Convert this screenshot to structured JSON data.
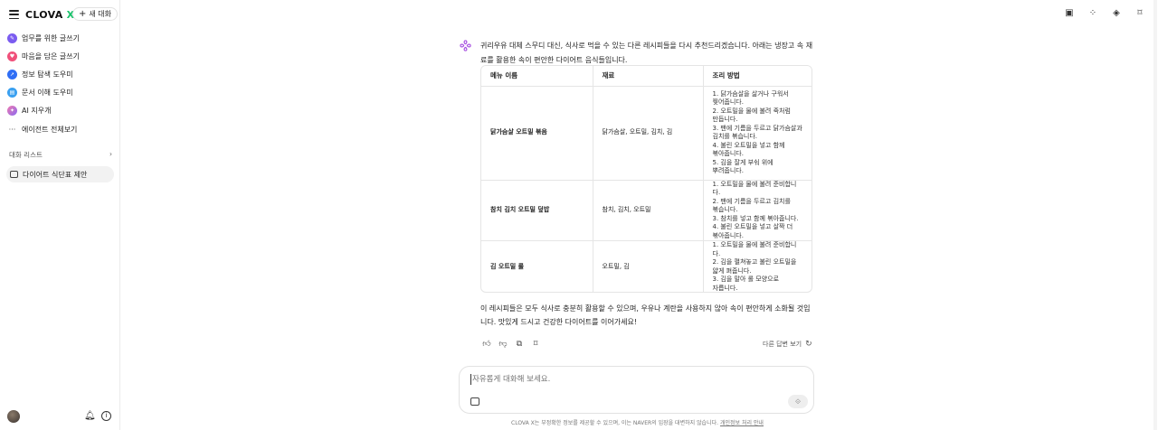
{
  "sidebar": {
    "logo": "CLOVA",
    "logo_x": "X",
    "new_chat": "새 대화",
    "agents": [
      {
        "label": "업무를 위한 글쓰기",
        "color": "#7b5cf0",
        "icon": "pencil-icon"
      },
      {
        "label": "마음을 담은 글쓰기",
        "color": "#f0507a",
        "icon": "heart-icon"
      },
      {
        "label": "정보 탐색 도우미",
        "color": "#2f6ef5",
        "icon": "compass-icon"
      },
      {
        "label": "문서 이해 도우미",
        "color": "#3aa0f0",
        "icon": "document-icon"
      },
      {
        "label": "AI 지우개",
        "color": "#c06af0",
        "icon": "eraser-icon"
      },
      {
        "label": "에이전트 전체보기",
        "color": "",
        "icon": "more-icon"
      }
    ],
    "chat_list_label": "대화 리스트",
    "chat_item": "다이어트 식단표 제안"
  },
  "message": {
    "intro": "귀리우유 대체 스무디 대신, 식사로 먹을 수 있는 다른 레시피들을 다시 추천드리겠습니다. 아래는 냉장고 속 재료를 활용한 속이 편안한 다이어트 음식들입니다.",
    "table": {
      "headers": [
        "메뉴 이름",
        "재료",
        "조리 방법"
      ],
      "rows": [
        {
          "menu": "닭가슴살 오트밀 볶음",
          "ingredients": "닭가슴살, 오트밀, 김치, 김",
          "method": "1. 닭가슴살을 삶거나 구워서\n찢어줍니다.\n2. 오트밀을 물에 불려 죽처럼\n만듭니다.\n3. 팬에 기름을 두르고 닭가슴살과\n김치를 볶습니다.\n4. 불린 오트밀을 넣고 함께\n볶아줍니다.\n5. 김을 잘게 부숴 위에\n뿌려줍니다."
        },
        {
          "menu": "참치 김치 오트밀 덮밥",
          "ingredients": "참치, 김치, 오트밀",
          "method": "1. 오트밀을 물에 불려 준비합니다.\n2. 팬에 기름을 두르고 김치를\n볶습니다.\n3. 참치를 넣고 함께 볶아줍니다.\n4. 불린 오트밀을 넣고 살짝 더\n볶아줍니다."
        },
        {
          "menu": "김 오트밀 롤",
          "ingredients": "오트밀, 김",
          "method": "1. 오트밀을 물에 불려 준비합니다.\n2. 김을 펼쳐놓고 불린 오트밀을\n얇게 펴줍니다.\n3. 김을 말아 롤 모양으로\n자릅니다."
        }
      ]
    },
    "outro": "이 레시피들은 모두 식사로 충분히 활용할 수 있으며, 우유나 계란을 사용하지 않아 속이 편안하게 소화될 것입니다. 맛있게 드시고 건강한 다이어트를 이어가세요!",
    "other_answer": "다른 답변 보기"
  },
  "input": {
    "placeholder": "자유롭게 대화해 보세요."
  },
  "footer": {
    "text": "CLOVA X는 부정확한 정보를 제공할 수 있으며, 이는 NAVER의 입장을 대변하지 않습니다.",
    "link": "개인정보 처리 안내"
  }
}
